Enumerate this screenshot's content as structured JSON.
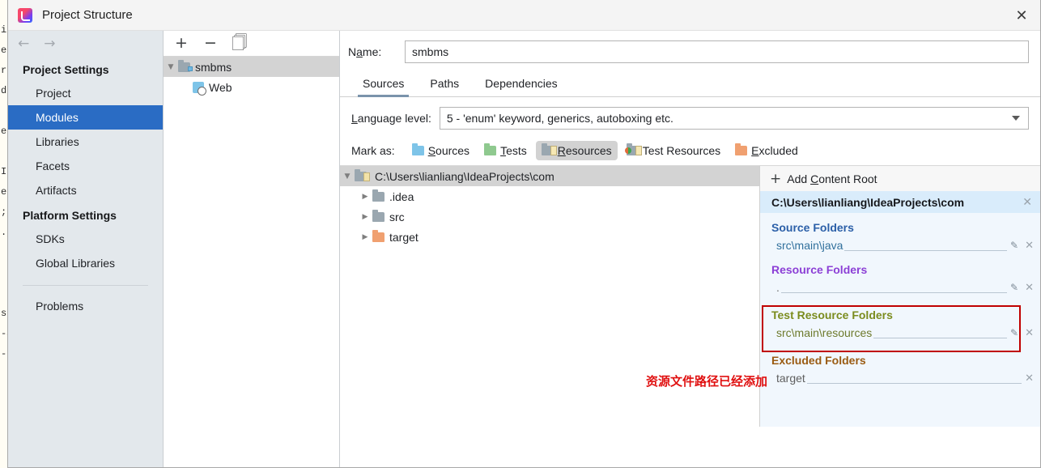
{
  "window": {
    "title": "Project Structure",
    "close_icon": "close-icon",
    "app_icon": "intellij-idea-icon"
  },
  "background_editor": {
    "lines": [
      "",
      "il",
      "es",
      "rc",
      "d",
      "",
      "e",
      "",
      "IN",
      "el",
      ";j",
      ".j",
      "",
      "",
      "",
      "su",
      "-S",
      "-"
    ]
  },
  "sidebar": {
    "back_icon": "arrow-left-icon",
    "forward_icon": "arrow-right-icon",
    "groups": [
      {
        "title": "Project Settings",
        "items": [
          {
            "label": "Project",
            "selected": false
          },
          {
            "label": "Modules",
            "selected": true
          },
          {
            "label": "Libraries",
            "selected": false
          },
          {
            "label": "Facets",
            "selected": false
          },
          {
            "label": "Artifacts",
            "selected": false
          }
        ]
      },
      {
        "title": "Platform Settings",
        "items": [
          {
            "label": "SDKs",
            "selected": false
          },
          {
            "label": "Global Libraries",
            "selected": false
          }
        ]
      }
    ],
    "problems_label": "Problems"
  },
  "modules_panel": {
    "toolbar": {
      "add_icon": "plus-icon",
      "remove_icon": "minus-icon",
      "copy_icon": "copy-icon"
    },
    "tree": [
      {
        "label": "smbms",
        "icon": "module-folder-icon",
        "selected": true,
        "expanded": true,
        "depth": 0
      },
      {
        "label": "Web",
        "icon": "web-facet-icon",
        "selected": false,
        "depth": 1
      }
    ]
  },
  "main": {
    "name_label_pre": "N",
    "name_label_underlined": "a",
    "name_label_post": "me:",
    "name_value": "smbms",
    "name_placeholder": "",
    "tabs": [
      {
        "label": "Sources",
        "active": true
      },
      {
        "label": "Paths",
        "active": false
      },
      {
        "label": "Dependencies",
        "active": false
      }
    ],
    "language_level": {
      "label_pre": "",
      "label_underlined": "L",
      "label_post": "anguage level:",
      "value": "5 - 'enum' keyword, generics, autoboxing etc.",
      "caret_icon": "chevron-down-icon"
    },
    "mark_as": {
      "label": "Mark as:",
      "buttons": [
        {
          "pre": "",
          "key": "S",
          "post": "ources",
          "icon": "folder-blue-icon",
          "pressed": false
        },
        {
          "pre": "",
          "key": "T",
          "post": "ests",
          "icon": "folder-green-icon",
          "pressed": false
        },
        {
          "pre": "",
          "key": "R",
          "post": "esources",
          "icon": "folder-resources-icon",
          "pressed": true
        },
        {
          "pre": "Test Resources",
          "key": "",
          "post": "",
          "icon": "folder-test-resources-icon",
          "pressed": false
        },
        {
          "pre": "",
          "key": "E",
          "post": "xcluded",
          "icon": "folder-orange-icon",
          "pressed": false
        }
      ]
    },
    "content_tree": [
      {
        "label": "C:\\Users\\lianliang\\IdeaProjects\\com",
        "icon": "folder-resources-icon",
        "depth": 0,
        "expanded": true,
        "selected": true
      },
      {
        "label": ".idea",
        "icon": "folder-gray-icon",
        "depth": 1,
        "expanded": false,
        "selected": false
      },
      {
        "label": "src",
        "icon": "folder-gray-icon",
        "depth": 1,
        "expanded": false,
        "selected": false
      },
      {
        "label": "target",
        "icon": "folder-orange-icon",
        "depth": 1,
        "expanded": false,
        "selected": false
      }
    ]
  },
  "roots_panel": {
    "add_content_root": {
      "pre": "Add ",
      "key": "C",
      "post": "ontent Root",
      "icon": "plus-icon"
    },
    "root_path": "C:\\Users\\lianliang\\IdeaProjects\\com",
    "root_close_icon": "close-icon",
    "groups": [
      {
        "title": "Source Folders",
        "color": "#2b5fa8",
        "entries": [
          {
            "path": "src\\main\\java",
            "has_pencil": true,
            "has_close": true
          }
        ]
      },
      {
        "title": "Resource Folders",
        "color": "#8c3fd6",
        "entries": [
          {
            "path": ".",
            "has_pencil": true,
            "has_close": true
          }
        ]
      },
      {
        "title": "Test Resource Folders",
        "color": "#7b8c1e",
        "entries": [
          {
            "path": "src\\main\\resources",
            "has_pencil": true,
            "has_close": true
          }
        ]
      },
      {
        "title": "Excluded Folders",
        "color": "#9a5b12",
        "entries": [
          {
            "path": "target",
            "has_pencil": false,
            "has_close": true
          }
        ]
      }
    ],
    "pencil_icon": "pencil-icon",
    "remove_entry_icon": "close-icon"
  },
  "annotation": {
    "text": "资源文件路径已经添加",
    "color": "#e01010",
    "highlight_box_color": "#c00000"
  }
}
